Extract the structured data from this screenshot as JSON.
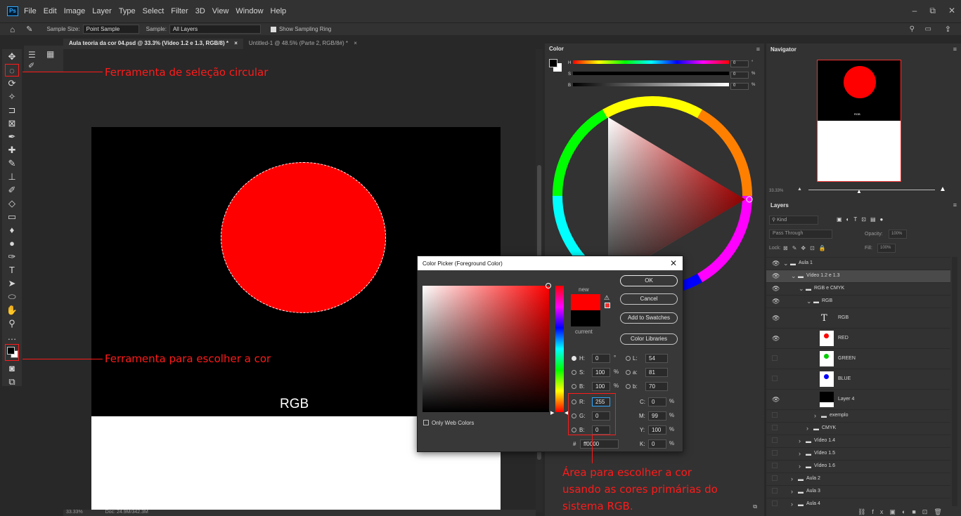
{
  "app": {
    "logo": "Ps",
    "menu": [
      "File",
      "Edit",
      "Image",
      "Layer",
      "Type",
      "Select",
      "Filter",
      "3D",
      "View",
      "Window",
      "Help"
    ],
    "window_controls": [
      "–",
      "⧉",
      "✕"
    ]
  },
  "options_bar": {
    "sample_size_label": "Sample Size:",
    "sample_size_value": "Point Sample",
    "sample_label": "Sample:",
    "sample_value": "All Layers",
    "show_ring_label": "Show Sampling Ring"
  },
  "tabs": [
    {
      "label": "Aula teoria da cor 04.psd @ 33.3% (Vídeo 1.2 e 1.3, RGB/8) *",
      "close": "×"
    },
    {
      "label": "Untitled-1 @ 48.5% (Parte 2, RGB/8#) *",
      "close": "×"
    }
  ],
  "canvas": {
    "text": "RGB",
    "status_zoom": "33.33%",
    "status_doc": "Doc: 24.9M/342.3M"
  },
  "color_panel": {
    "tab": "Color",
    "sliders": [
      {
        "label": "H",
        "value": "0",
        "unit": "°"
      },
      {
        "label": "S",
        "value": "0",
        "unit": "%"
      },
      {
        "label": "B",
        "value": "0",
        "unit": "%"
      }
    ]
  },
  "navigator": {
    "tab": "Navigator",
    "zoom": "33.33%",
    "thumb_text": "RGB"
  },
  "layers": {
    "tab": "Layers",
    "filter": "Kind",
    "blend_mode": "Pass Through",
    "opacity_label": "Opacity:",
    "opacity_value": "100%",
    "lock_label": "Lock:",
    "fill_label": "Fill:",
    "fill_value": "100%",
    "rows": [
      {
        "name": "Aula 1",
        "indent": 0,
        "type": "folder",
        "visible": true,
        "open": true
      },
      {
        "name": "Vídeo 1.2 e 1.3",
        "indent": 1,
        "type": "folder",
        "visible": true,
        "open": true,
        "selected": true
      },
      {
        "name": "RGB e CMYK",
        "indent": 2,
        "type": "folder",
        "visible": true,
        "open": true
      },
      {
        "name": "RGB",
        "indent": 3,
        "type": "folder",
        "visible": true,
        "open": true
      },
      {
        "name": "RGB",
        "indent": 4,
        "type": "text",
        "visible": true
      },
      {
        "name": "RED",
        "indent": 4,
        "type": "image",
        "visible": true,
        "swatch": "#ff0000"
      },
      {
        "name": "GREEN",
        "indent": 4,
        "type": "image",
        "visible": false,
        "swatch": "#00cc00"
      },
      {
        "name": "BLUE",
        "indent": 4,
        "type": "image",
        "visible": false,
        "swatch": "#0000ff"
      },
      {
        "name": "Layer 4",
        "indent": 4,
        "type": "image",
        "visible": true,
        "swatch": "#000000"
      },
      {
        "name": "exemplo",
        "indent": 4,
        "type": "folder",
        "visible": false,
        "open": false
      },
      {
        "name": "CMYK",
        "indent": 3,
        "type": "folder",
        "visible": false,
        "open": false
      },
      {
        "name": "Vídeo 1.4",
        "indent": 2,
        "type": "folder",
        "visible": false,
        "open": false
      },
      {
        "name": "Vídeo 1.5",
        "indent": 2,
        "type": "folder",
        "visible": false,
        "open": false
      },
      {
        "name": "Vídeo 1.6",
        "indent": 2,
        "type": "folder",
        "visible": false,
        "open": false
      },
      {
        "name": "Aula 2",
        "indent": 1,
        "type": "folder",
        "visible": false,
        "open": false
      },
      {
        "name": "Aula 3",
        "indent": 1,
        "type": "folder",
        "visible": false,
        "open": false
      },
      {
        "name": "Aula 4",
        "indent": 1,
        "type": "folder",
        "visible": false,
        "open": false
      }
    ]
  },
  "color_picker": {
    "title": "Color Picker (Foreground Color)",
    "close": "✕",
    "new_label": "new",
    "current_label": "current",
    "buttons": {
      "ok": "OK",
      "cancel": "Cancel",
      "swatches": "Add to Swatches",
      "libraries": "Color Libraries"
    },
    "only_web": "Only Web Colors",
    "fields": {
      "H": "0",
      "S": "100",
      "B": "100",
      "L": "54",
      "a": "81",
      "b": "70",
      "R": "255",
      "G": "0",
      "B2": "0",
      "C": "0",
      "M": "99",
      "Y": "100",
      "K": "0",
      "hex": "ff0000"
    },
    "labels": {
      "H": "H:",
      "S": "S:",
      "B": "B:",
      "L": "L:",
      "a": "a:",
      "b": "b:",
      "R": "R:",
      "G": "G:",
      "B2": "B:",
      "C": "C:",
      "M": "M:",
      "Y": "Y:",
      "K": "K:",
      "hex": "#"
    },
    "units": {
      "deg": "°",
      "pct": "%"
    },
    "new_color": "#ff0000",
    "current_color": "#000000"
  },
  "annotations": {
    "circular_select": "Ferramenta de seleção circular",
    "color_tool": "Ferramenta para escolher a cor",
    "rgb_area_1": "Área para escolher a cor",
    "rgb_area_2": "usando as cores primárias do",
    "rgb_area_3": "sistema RGB."
  },
  "colors": {
    "accent_annotation": "#ff1a1a",
    "red": "#ff0000"
  }
}
